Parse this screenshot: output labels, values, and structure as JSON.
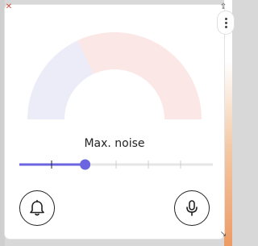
{
  "gauge": {
    "segments": [
      {
        "color": "#ececf8",
        "start_deg": 180,
        "end_deg": 245
      },
      {
        "color": "#fbe7e5",
        "start_deg": 245,
        "end_deg": 360
      }
    ]
  },
  "noise": {
    "label": "Max. noise",
    "value_fraction": 0.34,
    "tick_count": 7,
    "accent_color": "#6b66e0"
  },
  "buttons": {
    "bell_icon": "bell-icon",
    "mic_icon": "microphone-icon"
  },
  "corner_icons": {
    "top_left": "close-x",
    "top_right": "share-icon",
    "bottom_right": "resize-arrow-icon"
  }
}
